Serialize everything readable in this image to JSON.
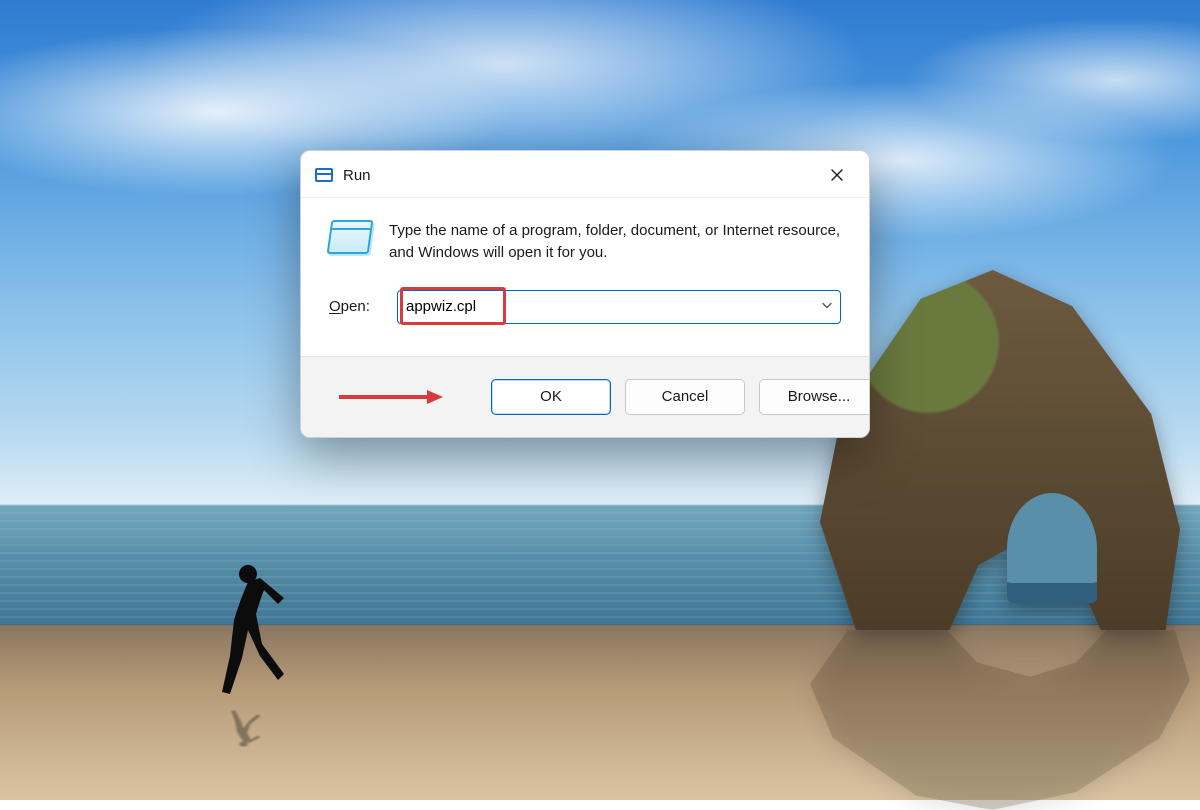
{
  "dialog": {
    "title": "Run",
    "description": "Type the name of a program, folder, document, or Internet resource, and Windows will open it for you.",
    "open_label_prefix": "O",
    "open_label_rest": "pen:",
    "input_value": "appwiz.cpl",
    "buttons": {
      "ok": "OK",
      "cancel": "Cancel",
      "browse": "Browse..."
    }
  },
  "annotation": {
    "highlight_color": "#d83b3b",
    "arrow_color": "#d83b3b"
  }
}
